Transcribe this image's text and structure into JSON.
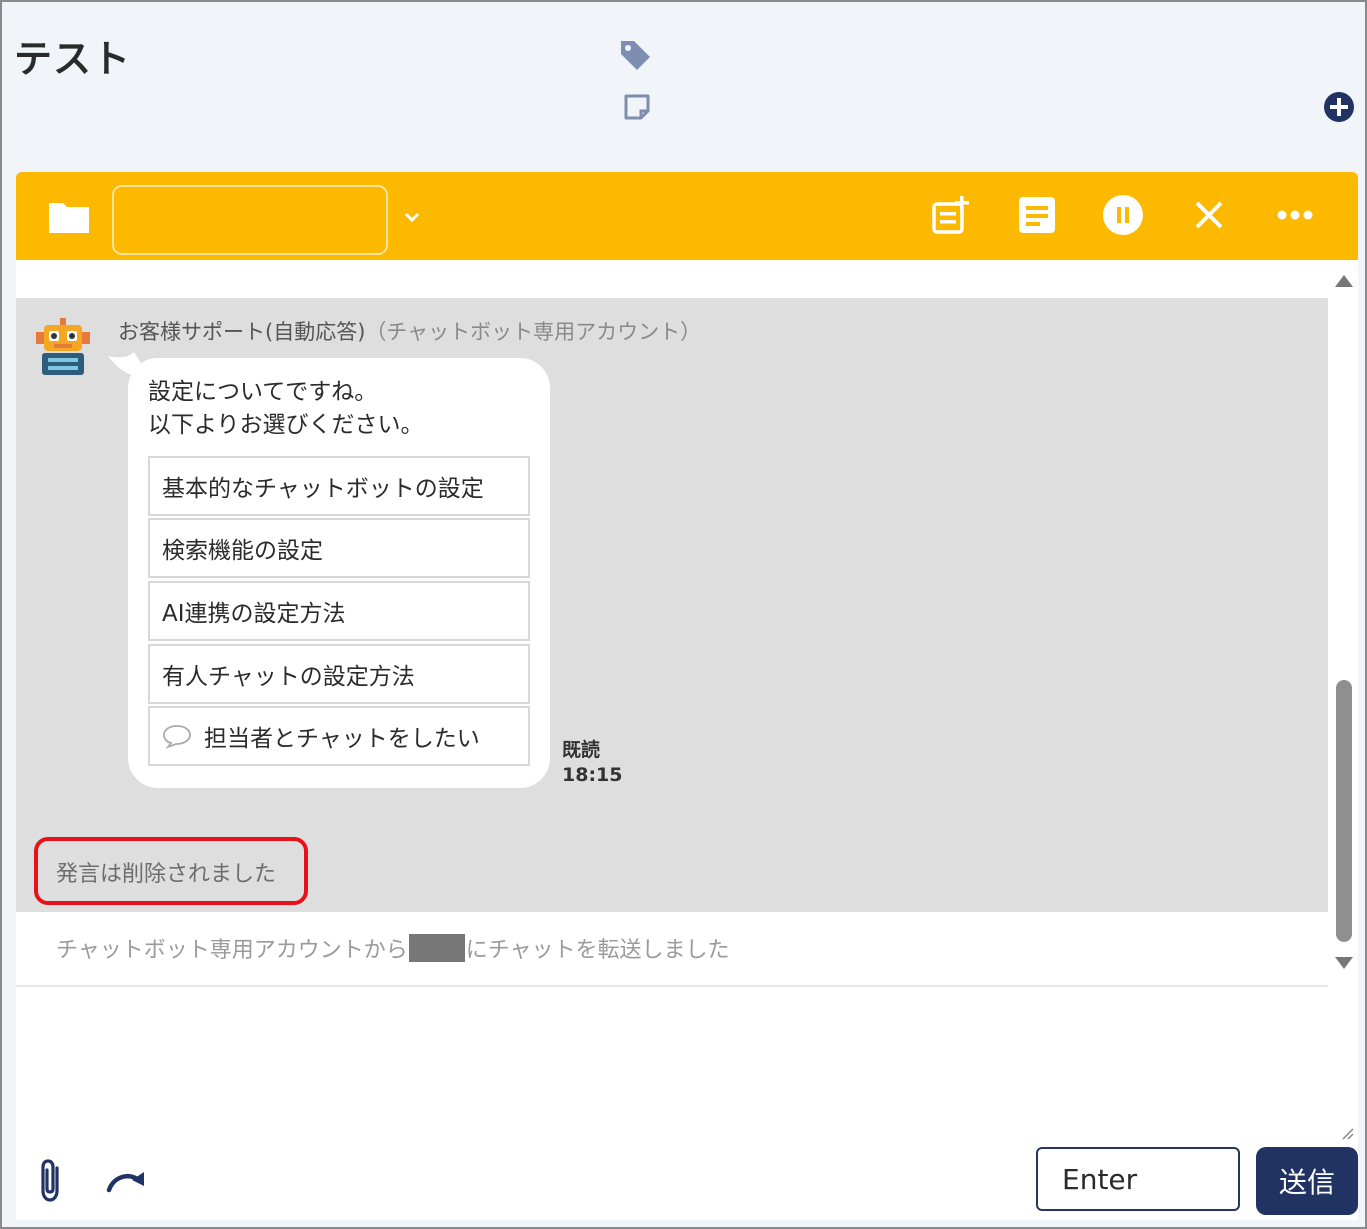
{
  "header": {
    "title": "テスト",
    "icons": [
      "tag-icon",
      "note-icon",
      "add-circle-icon"
    ]
  },
  "toolbar": {
    "icons": [
      "folder-icon",
      "chevron-down-icon",
      "memo-add-icon",
      "memo-icon",
      "pause-icon",
      "close-icon",
      "more-icon"
    ],
    "accent_color": "#fcb900"
  },
  "chat": {
    "sender_name": "お客様サポート(自動応答)",
    "sender_note": "（チャットボット専用アカウント）",
    "message_lines": [
      "設定についてですね。",
      "以下よりお選びください。"
    ],
    "choices": [
      "基本的なチャットボットの設定",
      "検索機能の設定",
      "AI連携の設定方法",
      "有人チャットの設定方法",
      "担当者とチャットをしたい"
    ],
    "read_label": "既読",
    "read_time": "18:15",
    "deleted_notice": "発言は削除されました",
    "transfer_before": "チャットボット専用アカウントから",
    "transfer_after": "にチャットを転送しました"
  },
  "composer": {
    "enter_label": "Enter",
    "send_label": "送信",
    "icons": [
      "paperclip-icon",
      "forward-icon"
    ],
    "send_color": "#213363"
  }
}
